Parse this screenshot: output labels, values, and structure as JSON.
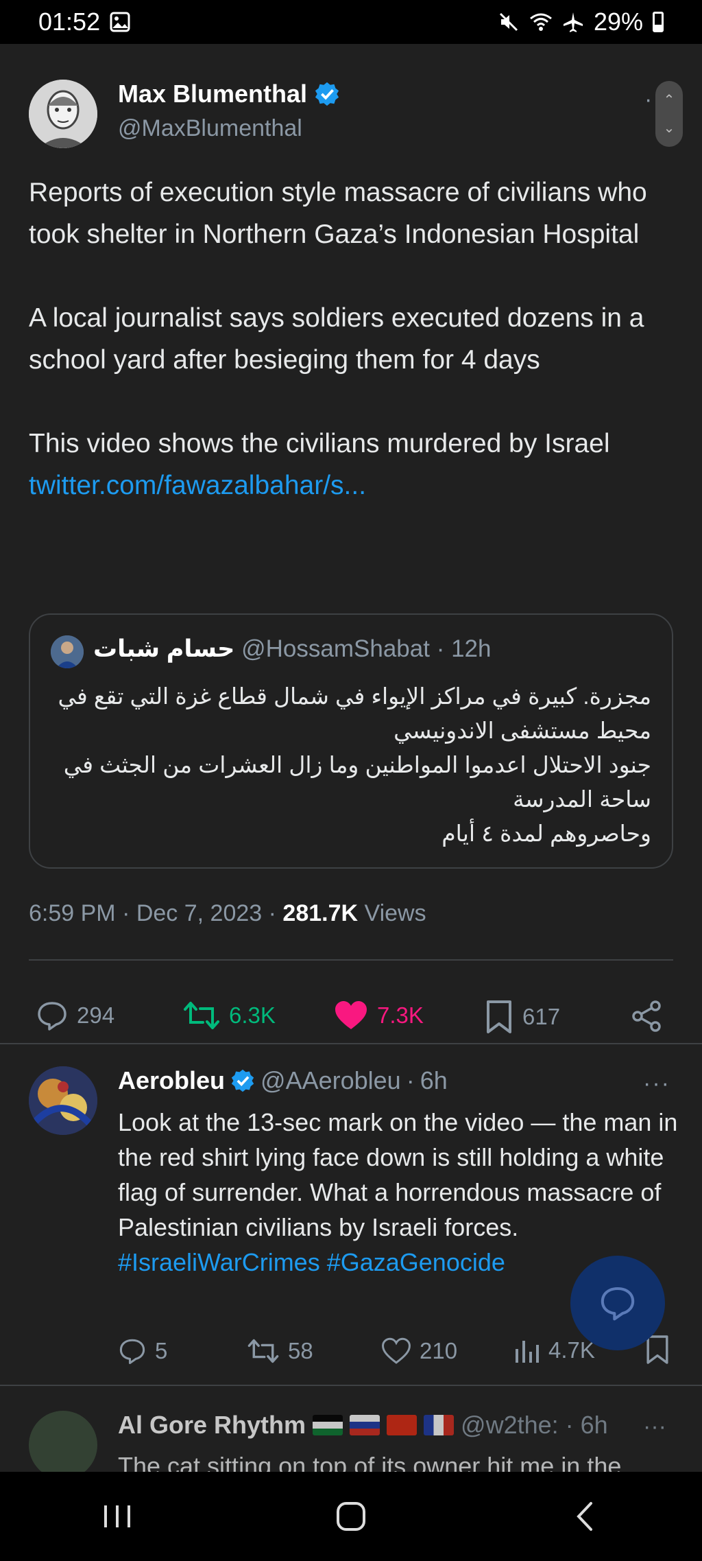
{
  "status_bar": {
    "time": "01:52",
    "battery": "29%",
    "icons": [
      "gallery-icon",
      "mute-icon",
      "wifi-icon",
      "airplane-icon",
      "battery-icon"
    ]
  },
  "tweet": {
    "author_name": "Max Blumenthal",
    "author_handle": "@MaxBlumenthal",
    "verified": true,
    "paragraphs": [
      "Reports of execution style massacre of civilians who took shelter in Northern Gaza’s Indonesian Hospital",
      "A local journalist says soldiers executed dozens in a school yard after besieging them for 4 days",
      "This video shows the civilians murdered by Israel"
    ],
    "link": "twitter.com/fawazalbahar/s...",
    "quoted": {
      "name": "حسام شبات",
      "handle": "@HossamShabat",
      "time": "12h",
      "lines": [
        "مجزرة. كبيرة في مراكز الإيواء في شمال قطاع غزة التي تقع في محيط مستشفى الاندونيسي",
        "جنود الاحتلال اعدموا المواطنين وما زال العشرات من الجثث في ساحة المدرسة",
        "وحاصروهم لمدة ٤ أيام"
      ]
    },
    "timestamp": "6:59 PM · Dec 7, 2023 · ",
    "views_count": "281.7K",
    "views_label": "Views",
    "actions": {
      "replies": "294",
      "retweets": "6.3K",
      "likes": "7.3K",
      "bookmarks": "617"
    }
  },
  "reply": {
    "author_name": "Aerobleu",
    "author_handle": "@AAerobleu",
    "time": "6h",
    "text": "Look at the 13-sec mark on the video — the man in the red shirt lying face down is still holding a white flag of surrender. What a horrendous massacre of Palestinian civilians by Israeli forces.",
    "hashtags": [
      "#IsraeliWarCrimes",
      "#GazaGenocide"
    ],
    "actions": {
      "replies": "5",
      "retweets": "58",
      "likes": "210",
      "views": "4.7K"
    }
  },
  "reply2": {
    "author_name": "Al Gore Rhythm",
    "author_handle": "@w2the:",
    "time": "6h",
    "text_preview": "The cat sitting on top of its owner hit me in the"
  },
  "colors": {
    "background": "#202020",
    "accent": "#1d9bf0",
    "retweet_active": "#00ba7c",
    "like_active": "#f91880",
    "muted": "#8b98a5"
  }
}
